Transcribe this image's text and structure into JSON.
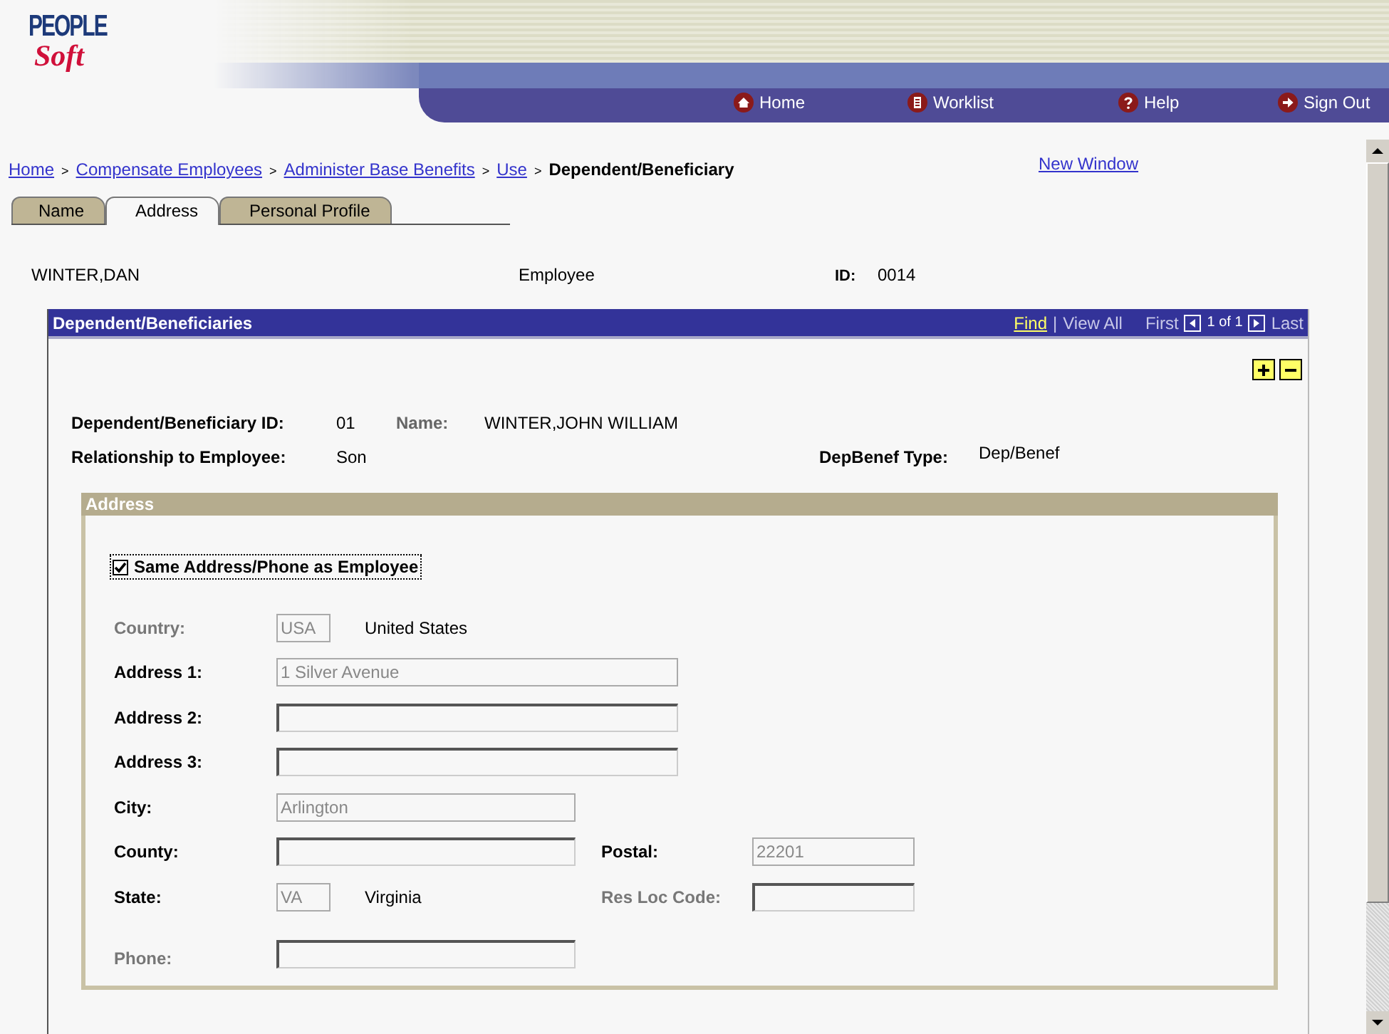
{
  "logo": {
    "line_1": "PEOPLE",
    "line_2": "Soft"
  },
  "nav": [
    {
      "label": "Home"
    },
    {
      "label": "Worklist"
    },
    {
      "label": "Help"
    },
    {
      "label": "Sign Out"
    }
  ],
  "breadcrumb": [
    {
      "label": "Home",
      "link": true
    },
    {
      "separator": ">",
      "label": "Compensate Employees",
      "link": true
    },
    {
      "separator": ">",
      "label": "Administer Base Benefits",
      "link": true
    },
    {
      "separator": ">",
      "label": "Use",
      "link": true
    },
    {
      "separator": ">",
      "label": "Dependent/Beneficiary",
      "link": false
    }
  ],
  "new_window": "New Window",
  "tabs": [
    {
      "label": "Name",
      "selected": false
    },
    {
      "label": "Address",
      "selected": true
    },
    {
      "label": "Personal Profile",
      "selected": false
    }
  ],
  "employee": {
    "name": "WINTER,DAN",
    "type": "Employee",
    "id_label": "ID:",
    "id": "0014"
  },
  "panel": {
    "title": "Dependent/Beneficiaries",
    "find": "Find",
    "divider": "|",
    "view_all": "View All",
    "first": "First",
    "count": "1 of 1",
    "last": "Last",
    "id_label": "Dependent/Beneficiary ID:",
    "id": "01",
    "name_label": "Name:",
    "name": "WINTER,JOHN WILLIAM",
    "relationship_label": "Relationship to Employee:",
    "relationship": "Son",
    "type_label": "DepBenef Type:",
    "type": "Dep/Benef"
  },
  "address": {
    "title": "Address",
    "same_as_employee": {
      "label": "Same Address/Phone as Employee",
      "checked": true
    },
    "rows": [
      {
        "label": "Country:",
        "label_disabled": true,
        "value": "USA",
        "kind": "short",
        "disabled": true,
        "description": "United States"
      },
      {
        "label": "Address 1:",
        "label_disabled": false,
        "value": "1 Silver Avenue",
        "kind": "long",
        "disabled": true
      },
      {
        "label": "Address 2:",
        "label_disabled": false,
        "kind": "long",
        "disabled": false
      },
      {
        "label": "Address 3:",
        "label_disabled": false,
        "kind": "long",
        "disabled": false
      },
      {
        "label": "City:",
        "label_disabled": false,
        "value": "Arlington",
        "kind": "medium",
        "disabled": true
      },
      {
        "label": "County:",
        "label_disabled": false,
        "kind": "medium",
        "disabled": false,
        "second": {
          "label": "Postal:",
          "label_disabled": false,
          "value": "22201",
          "disabled": true
        }
      },
      {
        "label": "State:",
        "label_disabled": false,
        "value": "VA",
        "kind": "short",
        "disabled": true,
        "description": "Virginia",
        "second": {
          "label": "Res Loc Code:",
          "label_disabled": true,
          "disabled": false
        }
      },
      {
        "label": "Phone:",
        "label_disabled": true,
        "kind": "medium",
        "disabled": false
      }
    ]
  }
}
